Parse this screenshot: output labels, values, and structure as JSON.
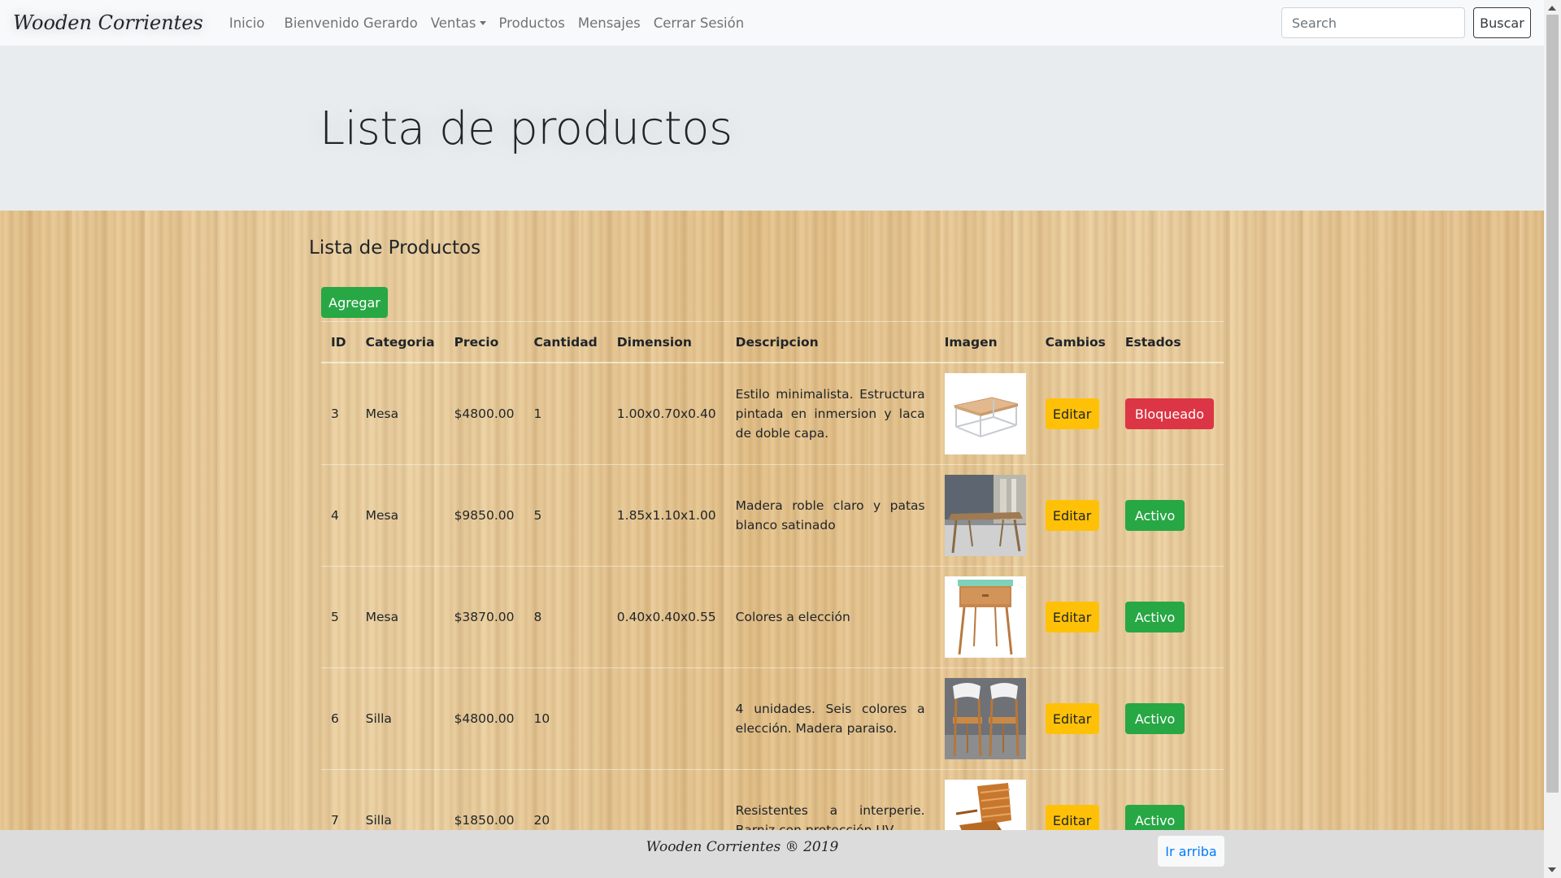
{
  "navbar": {
    "brand": "Wooden Corrientes",
    "links": [
      {
        "label": "Inicio"
      },
      {
        "label": "Bienvenido Gerardo"
      },
      {
        "label": "Ventas"
      },
      {
        "label": "Productos"
      },
      {
        "label": "Mensajes"
      },
      {
        "label": "Cerrar Sesión"
      }
    ],
    "search_placeholder": "Search",
    "search_button": "Buscar"
  },
  "jumbotron": {
    "title": "Lista de productos"
  },
  "main": {
    "section_title": "Lista de Productos",
    "add_button": "Agregar",
    "table": {
      "headers": [
        "ID",
        "Categoria",
        "Precio",
        "Cantidad",
        "Dimension",
        "Descripcion",
        "Imagen",
        "Cambios",
        "Estados"
      ],
      "rows": [
        {
          "id": "3",
          "categoria": "Mesa",
          "precio": "$4800.00",
          "cantidad": "1",
          "dimension": "1.00x0.70x0.40",
          "descripcion": "Estilo minimalista. Estructura pintada en inmersion y laca de doble capa.",
          "imagen": "coffee-table-image",
          "cambios": "Editar",
          "estado": "Bloqueado",
          "estado_color": "#dc3545"
        },
        {
          "id": "4",
          "categoria": "Mesa",
          "precio": "$9850.00",
          "cantidad": "5",
          "dimension": "1.85x1.10x1.00",
          "descripcion": "Madera roble claro y patas blanco satinado",
          "imagen": "dining-table-image",
          "cambios": "Editar",
          "estado": "Activo",
          "estado_color": "#28a745"
        },
        {
          "id": "5",
          "categoria": "Mesa",
          "precio": "$3870.00",
          "cantidad": "8",
          "dimension": "0.40x0.40x0.55",
          "descripcion": "Colores a elección",
          "imagen": "side-table-image",
          "cambios": "Editar",
          "estado": "Activo",
          "estado_color": "#28a745"
        },
        {
          "id": "6",
          "categoria": "Silla",
          "precio": "$4800.00",
          "cantidad": "10",
          "dimension": "",
          "descripcion": "4 unidades. Seis colores a elección. Madera paraiso.",
          "imagen": "chairs-image",
          "cambios": "Editar",
          "estado": "Activo",
          "estado_color": "#28a745"
        },
        {
          "id": "7",
          "categoria": "Silla",
          "precio": "$1850.00",
          "cantidad": "20",
          "dimension": "",
          "descripcion": "Resistentes a interperie. Barniz con protección UV",
          "imagen": "folding-chair-image",
          "cambios": "Editar",
          "estado": "Activo",
          "estado_color": "#28a745"
        }
      ]
    }
  },
  "footer": {
    "text": "Wooden Corrientes ® 2019",
    "top_button": "Ir arriba"
  },
  "colors": {
    "success": "#28a745",
    "danger": "#dc3545",
    "warning": "#ffc107",
    "link": "#007bff"
  }
}
